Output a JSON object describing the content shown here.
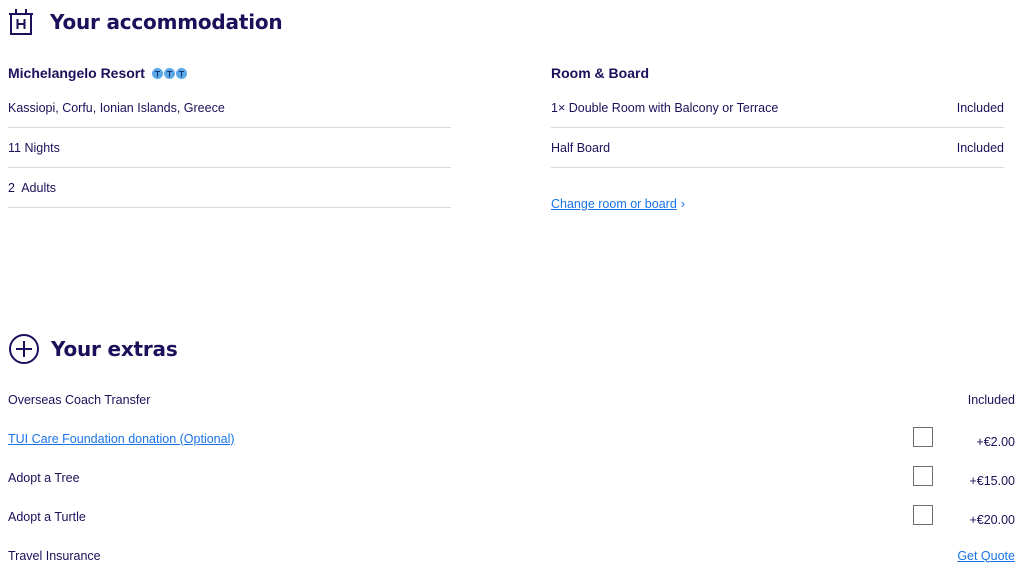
{
  "accommodation": {
    "title": "Your accommodation",
    "icon": "hotel-icon",
    "hotel": {
      "name": "Michelangelo Resort",
      "rating": 3,
      "rating_color": "#5ba8e6",
      "details": [
        "Kassiopi, Corfu, Ionian Islands, Greece",
        "11 Nights",
        "2  Adults"
      ]
    },
    "room_board": {
      "heading": "Room & Board",
      "items": [
        {
          "label": "1× Double Room with Balcony or Terrace",
          "status": "Included"
        },
        {
          "label": "Half Board",
          "status": "Included"
        }
      ],
      "change_link": "Change room or board",
      "change_chevron": "›"
    }
  },
  "extras": {
    "title": "Your extras",
    "icon": "plus-circle-icon",
    "items": [
      {
        "label": "Overseas Coach Transfer",
        "price": "Included"
      },
      {
        "label": "TUI Care Foundation donation (Optional)",
        "price": "+€2.00"
      },
      {
        "label": "Adopt a Tree",
        "price": "+€15.00"
      },
      {
        "label": "Adopt a Turtle",
        "price": "+€20.00"
      },
      {
        "label": "Travel Insurance",
        "price": "Get Quote"
      }
    ]
  },
  "colors": {
    "heading": "#1a115a",
    "link": "#1a73e8",
    "divider": "#d9d9d9"
  }
}
